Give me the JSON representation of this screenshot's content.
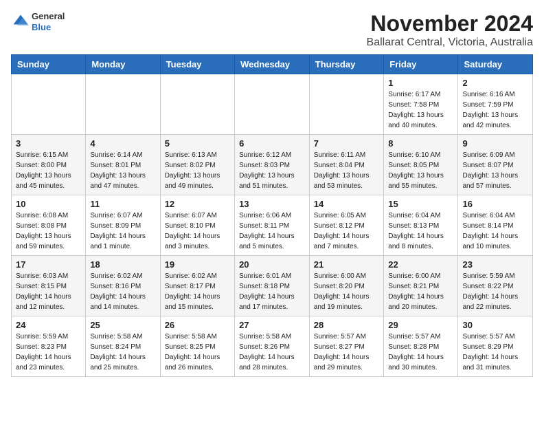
{
  "header": {
    "logo_general": "General",
    "logo_blue": "Blue",
    "month_title": "November 2024",
    "location": "Ballarat Central, Victoria, Australia"
  },
  "weekdays": [
    "Sunday",
    "Monday",
    "Tuesday",
    "Wednesday",
    "Thursday",
    "Friday",
    "Saturday"
  ],
  "weeks": [
    [
      {
        "day": "",
        "detail": ""
      },
      {
        "day": "",
        "detail": ""
      },
      {
        "day": "",
        "detail": ""
      },
      {
        "day": "",
        "detail": ""
      },
      {
        "day": "",
        "detail": ""
      },
      {
        "day": "1",
        "detail": "Sunrise: 6:17 AM\nSunset: 7:58 PM\nDaylight: 13 hours\nand 40 minutes."
      },
      {
        "day": "2",
        "detail": "Sunrise: 6:16 AM\nSunset: 7:59 PM\nDaylight: 13 hours\nand 42 minutes."
      }
    ],
    [
      {
        "day": "3",
        "detail": "Sunrise: 6:15 AM\nSunset: 8:00 PM\nDaylight: 13 hours\nand 45 minutes."
      },
      {
        "day": "4",
        "detail": "Sunrise: 6:14 AM\nSunset: 8:01 PM\nDaylight: 13 hours\nand 47 minutes."
      },
      {
        "day": "5",
        "detail": "Sunrise: 6:13 AM\nSunset: 8:02 PM\nDaylight: 13 hours\nand 49 minutes."
      },
      {
        "day": "6",
        "detail": "Sunrise: 6:12 AM\nSunset: 8:03 PM\nDaylight: 13 hours\nand 51 minutes."
      },
      {
        "day": "7",
        "detail": "Sunrise: 6:11 AM\nSunset: 8:04 PM\nDaylight: 13 hours\nand 53 minutes."
      },
      {
        "day": "8",
        "detail": "Sunrise: 6:10 AM\nSunset: 8:05 PM\nDaylight: 13 hours\nand 55 minutes."
      },
      {
        "day": "9",
        "detail": "Sunrise: 6:09 AM\nSunset: 8:07 PM\nDaylight: 13 hours\nand 57 minutes."
      }
    ],
    [
      {
        "day": "10",
        "detail": "Sunrise: 6:08 AM\nSunset: 8:08 PM\nDaylight: 13 hours\nand 59 minutes."
      },
      {
        "day": "11",
        "detail": "Sunrise: 6:07 AM\nSunset: 8:09 PM\nDaylight: 14 hours\nand 1 minute."
      },
      {
        "day": "12",
        "detail": "Sunrise: 6:07 AM\nSunset: 8:10 PM\nDaylight: 14 hours\nand 3 minutes."
      },
      {
        "day": "13",
        "detail": "Sunrise: 6:06 AM\nSunset: 8:11 PM\nDaylight: 14 hours\nand 5 minutes."
      },
      {
        "day": "14",
        "detail": "Sunrise: 6:05 AM\nSunset: 8:12 PM\nDaylight: 14 hours\nand 7 minutes."
      },
      {
        "day": "15",
        "detail": "Sunrise: 6:04 AM\nSunset: 8:13 PM\nDaylight: 14 hours\nand 8 minutes."
      },
      {
        "day": "16",
        "detail": "Sunrise: 6:04 AM\nSunset: 8:14 PM\nDaylight: 14 hours\nand 10 minutes."
      }
    ],
    [
      {
        "day": "17",
        "detail": "Sunrise: 6:03 AM\nSunset: 8:15 PM\nDaylight: 14 hours\nand 12 minutes."
      },
      {
        "day": "18",
        "detail": "Sunrise: 6:02 AM\nSunset: 8:16 PM\nDaylight: 14 hours\nand 14 minutes."
      },
      {
        "day": "19",
        "detail": "Sunrise: 6:02 AM\nSunset: 8:17 PM\nDaylight: 14 hours\nand 15 minutes."
      },
      {
        "day": "20",
        "detail": "Sunrise: 6:01 AM\nSunset: 8:18 PM\nDaylight: 14 hours\nand 17 minutes."
      },
      {
        "day": "21",
        "detail": "Sunrise: 6:00 AM\nSunset: 8:20 PM\nDaylight: 14 hours\nand 19 minutes."
      },
      {
        "day": "22",
        "detail": "Sunrise: 6:00 AM\nSunset: 8:21 PM\nDaylight: 14 hours\nand 20 minutes."
      },
      {
        "day": "23",
        "detail": "Sunrise: 5:59 AM\nSunset: 8:22 PM\nDaylight: 14 hours\nand 22 minutes."
      }
    ],
    [
      {
        "day": "24",
        "detail": "Sunrise: 5:59 AM\nSunset: 8:23 PM\nDaylight: 14 hours\nand 23 minutes."
      },
      {
        "day": "25",
        "detail": "Sunrise: 5:58 AM\nSunset: 8:24 PM\nDaylight: 14 hours\nand 25 minutes."
      },
      {
        "day": "26",
        "detail": "Sunrise: 5:58 AM\nSunset: 8:25 PM\nDaylight: 14 hours\nand 26 minutes."
      },
      {
        "day": "27",
        "detail": "Sunrise: 5:58 AM\nSunset: 8:26 PM\nDaylight: 14 hours\nand 28 minutes."
      },
      {
        "day": "28",
        "detail": "Sunrise: 5:57 AM\nSunset: 8:27 PM\nDaylight: 14 hours\nand 29 minutes."
      },
      {
        "day": "29",
        "detail": "Sunrise: 5:57 AM\nSunset: 8:28 PM\nDaylight: 14 hours\nand 30 minutes."
      },
      {
        "day": "30",
        "detail": "Sunrise: 5:57 AM\nSunset: 8:29 PM\nDaylight: 14 hours\nand 31 minutes."
      }
    ]
  ]
}
